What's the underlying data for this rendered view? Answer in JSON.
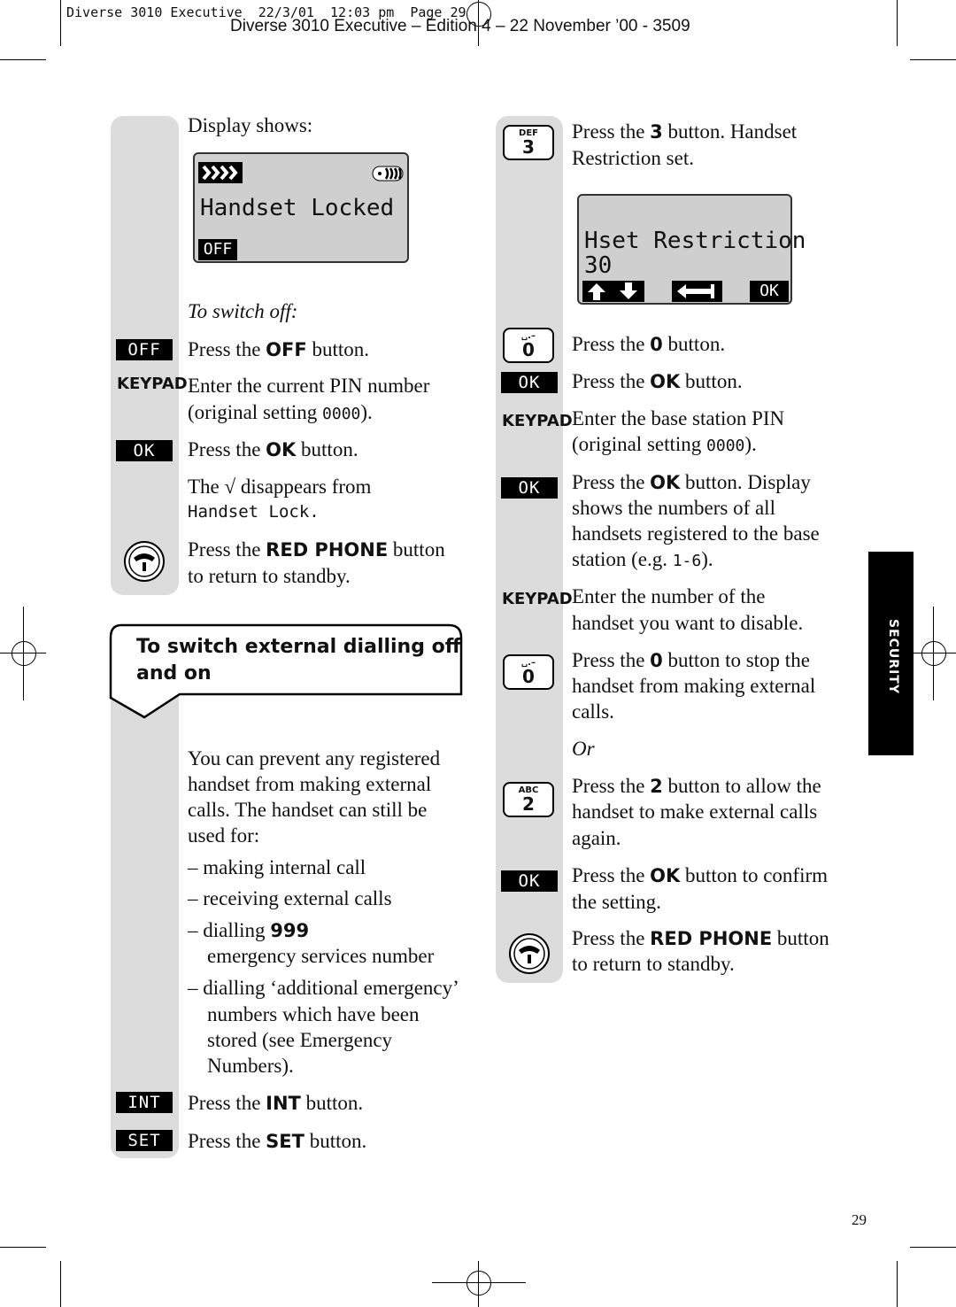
{
  "header": {
    "slug": "Diverse 3010 Executive  22/3/01  12:03 pm  Page 29",
    "edition": "Diverse 3010 Executive – Edition 4 – 22 November ’00 - 3509"
  },
  "left": {
    "display1": {
      "signal_icon": "signal-arrows-icon",
      "battery_icon": "battery-icon",
      "text": "Handset Locked",
      "softkey": "OFF"
    },
    "keys": [
      {
        "type": "softkey",
        "label": "OFF"
      },
      {
        "type": "text",
        "label": "KEYPAD"
      },
      {
        "type": "softkey",
        "label": "OK"
      },
      {
        "type": "icon",
        "label": "red-phone-icon"
      },
      {
        "type": "softkey",
        "label": "INT"
      },
      {
        "type": "softkey",
        "label": "SET"
      }
    ],
    "heading": [
      "To switch external dialling off",
      "and on"
    ],
    "lines": [
      [
        "Display shows:"
      ],
      [
        {
          "i": "To switch off:"
        }
      ],
      [
        "Press the ",
        {
          "b": "OFF"
        },
        " button."
      ],
      [
        "Enter the current PIN number"
      ],
      [
        "(original setting ",
        {
          "m": "0000"
        },
        ")."
      ],
      [
        "Press the ",
        {
          "b": "OK"
        },
        " button."
      ],
      [
        "The √ disappears from"
      ],
      [
        {
          "mono": "Handset Lock."
        }
      ],
      [
        "Press the ",
        {
          "b": "RED PHONE"
        },
        " button"
      ],
      [
        "to return to standby."
      ],
      [
        "You can prevent any registered"
      ],
      [
        "handset from making external"
      ],
      [
        "calls. The handset can still be"
      ],
      [
        "used for:"
      ],
      [
        "–  making internal call"
      ],
      [
        "–  receiving external calls"
      ],
      [
        "–  dialling ",
        {
          "b": "999"
        }
      ],
      [
        "emergency services number"
      ],
      [
        "–  dialling ‘additional emergency’"
      ],
      [
        "numbers which have been"
      ],
      [
        "stored (see Emergency"
      ],
      [
        "Numbers)."
      ],
      [
        "Press the ",
        {
          "b": "INT"
        },
        " button."
      ],
      [
        "Press the ",
        {
          "b": "SET"
        },
        " button."
      ]
    ]
  },
  "right": {
    "display2": {
      "line1": "Hset Restriction",
      "line2": "30",
      "softkeys": [
        "up-arrow-icon",
        "down-arrow-icon",
        "back-arrow-icon",
        "OK"
      ]
    },
    "keys": [
      {
        "type": "numkey",
        "letters": "DEF",
        "label": "3"
      },
      {
        "type": "numkey",
        "letters": "␣.–",
        "label": "0"
      },
      {
        "type": "softkey",
        "label": "OK"
      },
      {
        "type": "text",
        "label": "KEYPAD"
      },
      {
        "type": "softkey",
        "label": "OK"
      },
      {
        "type": "text",
        "label": "KEYPAD"
      },
      {
        "type": "numkey",
        "letters": "␣.–",
        "label": "0"
      },
      {
        "type": "numkey",
        "letters": "ABC",
        "label": "2"
      },
      {
        "type": "softkey",
        "label": "OK"
      },
      {
        "type": "icon",
        "label": "red-phone-icon"
      }
    ],
    "lines": [
      [
        "Press the ",
        {
          "b": "3"
        },
        " button.  Handset"
      ],
      [
        "Restriction set."
      ],
      [
        "Press the ",
        {
          "b": "0"
        },
        " button."
      ],
      [
        "Press the ",
        {
          "b": "OK"
        },
        "  button."
      ],
      [
        "Enter the base station PIN"
      ],
      [
        "(original setting ",
        {
          "m": "0000"
        },
        ")."
      ],
      [
        "Press the ",
        {
          "b": "OK"
        },
        " button. Display"
      ],
      [
        "shows the numbers of all"
      ],
      [
        "handsets registered to the base"
      ],
      [
        "station (e.g. ",
        {
          "m": "1-6"
        },
        ")."
      ],
      [
        "Enter the number of the"
      ],
      [
        "handset you want to disable."
      ],
      [
        "Press the ",
        {
          "b": "0"
        },
        " button to stop the"
      ],
      [
        "handset from making external"
      ],
      [
        "calls."
      ],
      [
        {
          "i": "Or"
        }
      ],
      [
        "Press the ",
        {
          "b": "2"
        },
        " button to allow the"
      ],
      [
        "handset to make external calls"
      ],
      [
        "again."
      ],
      [
        "Press the ",
        {
          "b": "OK"
        },
        " button to confirm"
      ],
      [
        "the setting."
      ],
      [
        "Press the ",
        {
          "b": "RED PHONE"
        },
        " button"
      ],
      [
        "to return to standby."
      ]
    ]
  },
  "side_tab": "SECURITY",
  "page_number": "29"
}
